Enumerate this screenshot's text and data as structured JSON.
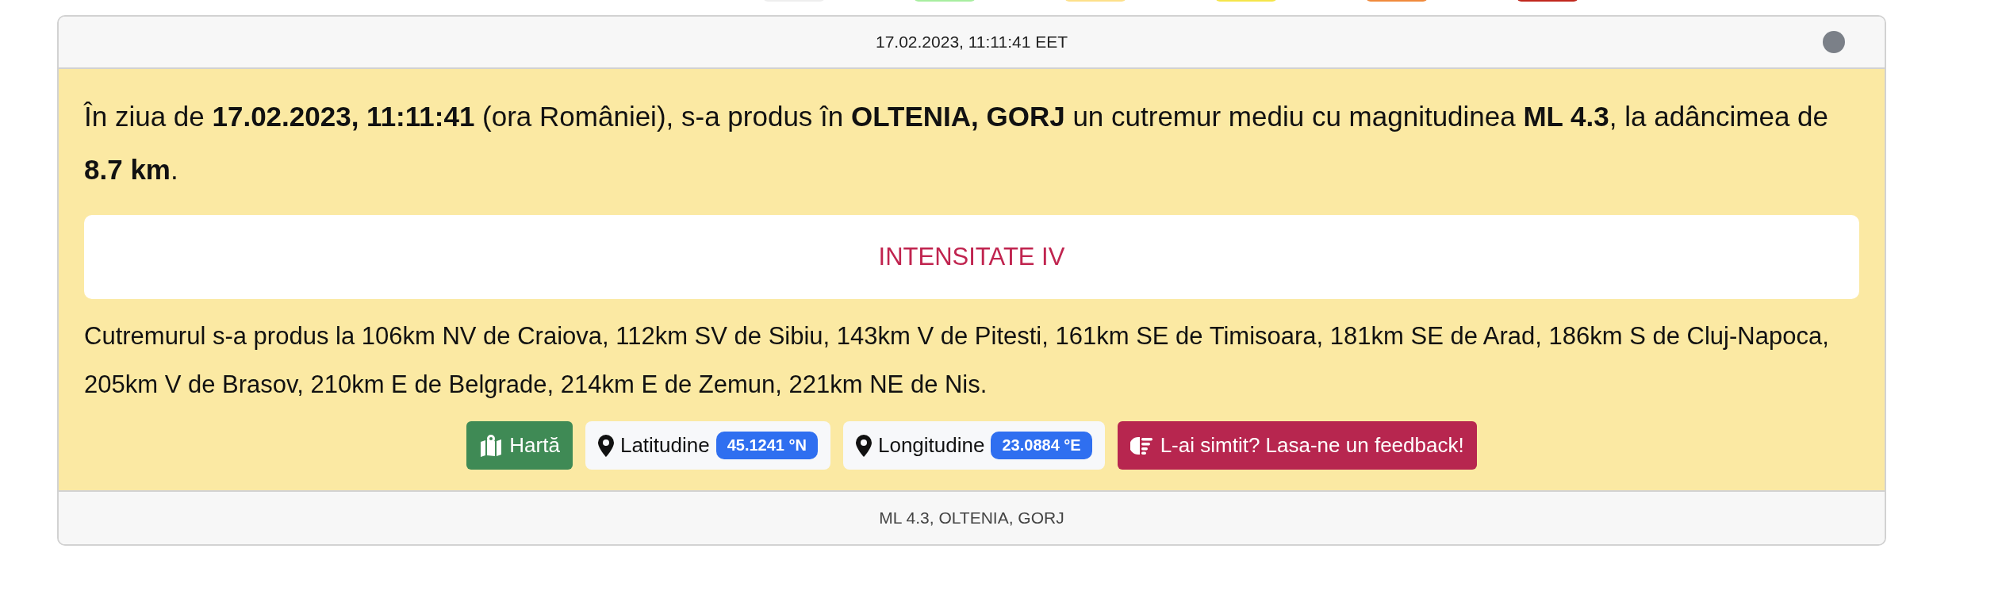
{
  "scale_swatches": [
    {
      "color": "#eeeeee"
    },
    {
      "color": "#a8eea0"
    },
    {
      "color": "#fde08a"
    },
    {
      "color": "#f5e54a"
    },
    {
      "color": "#f08a3c"
    },
    {
      "color": "#c0281e"
    }
  ],
  "card": {
    "header": "17.02.2023, 11:11:41 EET",
    "status_dot": {
      "color": "#7b8088"
    },
    "summary": "În ziua de **17.02.2023, 11:11:41** (ora României), s-a produs în **OLTENIA, GORJ** un cutremur mediu cu magnitudinea **ML 4.3**, la adâncimea de **8.7 km**.",
    "intensity": "INTENSITATE IV",
    "distances": "Cutremurul s-a produs la 106km NV de Craiova, 112km SV de Sibiu, 143km V de Pitesti, 161km SE de Timisoara, 181km SE de Arad, 186km S de Cluj-Napoca, 205km V de Brasov, 210km E de Belgrade, 214km E de Zemun, 221km NE de Nis.",
    "actions": [
      {
        "kind": "map",
        "label": "Hartă"
      },
      {
        "kind": "coordinate",
        "label": "Latitudine",
        "value": "45.1241 °N"
      },
      {
        "kind": "coordinate",
        "label": "Longitudine",
        "value": "23.0884 °E"
      },
      {
        "kind": "feedback",
        "label": "L-ai simtit? Lasa-ne un feedback!"
      }
    ],
    "footer": "ML 4.3, OLTENIA, GORJ"
  }
}
